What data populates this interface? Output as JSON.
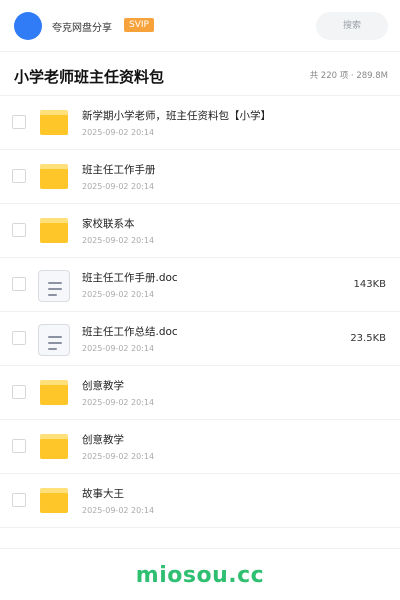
{
  "header": {
    "brand": "夸克网盘分享",
    "badge": "SVIP",
    "search_placeholder": "搜索"
  },
  "folder": {
    "title": "小学老师班主任资料包",
    "meta": "共 220 项 · 289.8M"
  },
  "items": [
    {
      "name": "新学期小学老师，班主任资料包【小学】",
      "date": "2025-09-02 20:14",
      "size": "",
      "type": "folder"
    },
    {
      "name": "班主任工作手册",
      "date": "2025-09-02 20:14",
      "size": "",
      "type": "folder"
    },
    {
      "name": "家校联系本",
      "date": "2025-09-02 20:14",
      "size": "",
      "type": "folder"
    },
    {
      "name": "班主任工作手册.doc",
      "date": "2025-09-02 20:14",
      "size": "143KB",
      "type": "doc"
    },
    {
      "name": "班主任工作总结.doc",
      "date": "2025-09-02 20:14",
      "size": "23.5KB",
      "type": "doc"
    },
    {
      "name": "创意教学",
      "date": "2025-09-02 20:14",
      "size": "",
      "type": "folder"
    },
    {
      "name": "创意教学",
      "date": "2025-09-02 20:14",
      "size": "",
      "type": "folder"
    },
    {
      "name": "故事大王",
      "date": "2025-09-02 20:14",
      "size": "",
      "type": "folder"
    }
  ],
  "footer": {
    "watermark": "miosou.cc"
  },
  "colors": {
    "avatar": "#2f7cf6",
    "badge": "#f7a23b",
    "folder": "#ffc629",
    "watermark": "#2fbf71"
  }
}
